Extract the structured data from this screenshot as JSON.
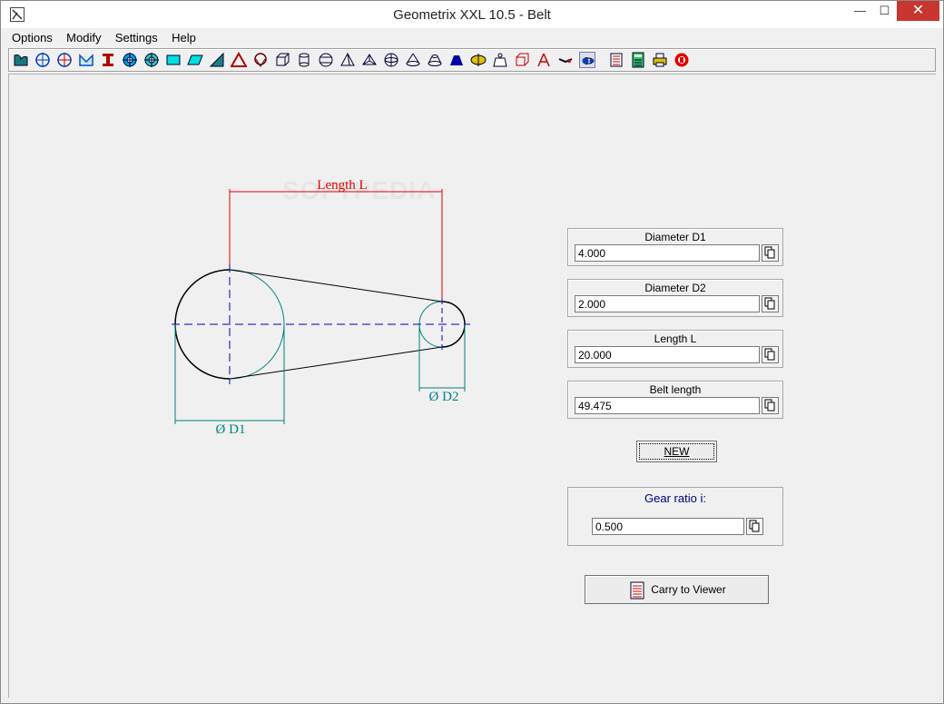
{
  "window": {
    "title": "Geometrix XXL 10.5 - Belt",
    "minimize": "—",
    "maximize": "☐",
    "close": "✕"
  },
  "menu": [
    "Options",
    "Modify",
    "Settings",
    "Help"
  ],
  "toolbar_icons": [
    "curve-shape-icon",
    "circle-crosshair-icon",
    "circle-crosshair-red-icon",
    "m-profile-icon",
    "i-beam-icon",
    "circle-target-icon",
    "gear-circle-icon",
    "rectangle-icon",
    "parallelogram-icon",
    "right-triangle-icon",
    "triangle-icon",
    "cone-top-icon",
    "cube-icon",
    "cylinder-icon",
    "barrel-icon",
    "pyramid-icon",
    "tetrahedron-icon",
    "sphere-icon",
    "cone-icon",
    "frustum-icon",
    "trapezoid-solid-icon",
    "ellipsoid-icon",
    "weight-icon",
    "cm3-icon",
    "compass-icon",
    "sword-icon",
    "belt-icon",
    "notebook-icon",
    "calculator-icon",
    "printer-icon",
    "exit-icon"
  ],
  "drawing": {
    "length_label": "Length L",
    "d1_label": "Ø  D1",
    "d2_label": "Ø  D2",
    "watermark": "SOFTPEDIA",
    "colors": {
      "belt": "#000000",
      "circle": "#008080",
      "length_dim": "#e00000",
      "center": "#0000c0",
      "dia_dim": "#008080"
    }
  },
  "fields": [
    {
      "label": "Diameter D1",
      "value": "4.000"
    },
    {
      "label": "Diameter D2",
      "value": "2.000"
    },
    {
      "label": "Length L",
      "value": "20.000"
    },
    {
      "label": "Belt length",
      "value": "49.475"
    }
  ],
  "new_button": "NEW",
  "gear": {
    "label": "Gear ratio i:",
    "value": "0.500"
  },
  "carry_button": "Carry to Viewer"
}
